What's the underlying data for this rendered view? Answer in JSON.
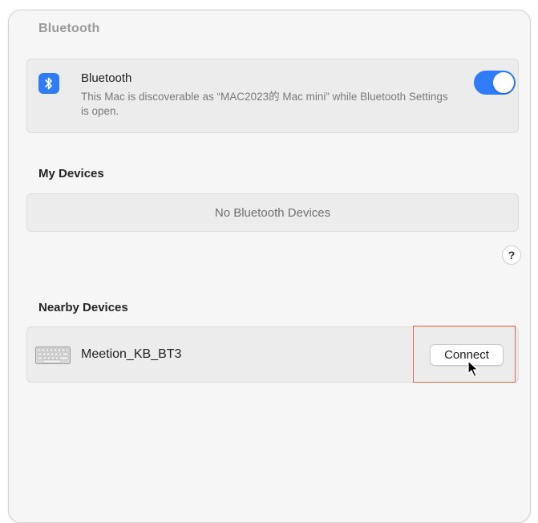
{
  "window": {
    "title": "Bluetooth"
  },
  "bluetooth": {
    "icon": "bluetooth-icon",
    "name": "Bluetooth",
    "description": "This Mac is discoverable as “MAC2023的 Mac mini” while Bluetooth Settings is open.",
    "toggle_on": true,
    "accent_color": "#2f7cf6"
  },
  "my_devices": {
    "title": "My Devices",
    "empty_text": "No Bluetooth Devices"
  },
  "help": {
    "label": "?"
  },
  "nearby_devices": {
    "title": "Nearby Devices",
    "items": [
      {
        "icon": "keyboard-icon",
        "name": "Meetion_KB_BT3",
        "action_label": "Connect"
      }
    ]
  },
  "highlight_color": "#e06a4a"
}
